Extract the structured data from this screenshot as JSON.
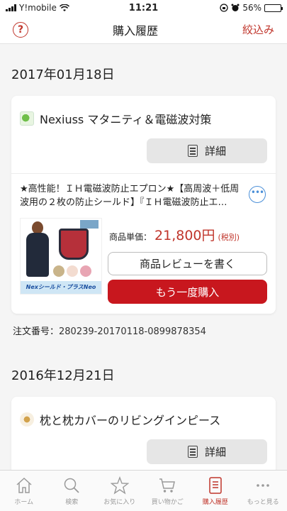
{
  "status_bar": {
    "carrier": "Y!mobile",
    "time": "11:21",
    "battery": "56%",
    "battery_level": 0.56
  },
  "header": {
    "title": "購入履歴",
    "filter_label": "絞込み"
  },
  "orders": [
    {
      "date": "2017年01月18日",
      "shop_name": "Nexiuss マタニティ＆電磁波対策",
      "detail_label": "詳細",
      "item": {
        "title": "★高性能！ＩＨ電磁波防止エプロン★【高周波＋低周波用の２枚の防止シールド】『ＩＨ電磁波防止エ…",
        "thumb_caption": "Nexシールド・プラスNeo",
        "price_label": "商品単価：",
        "price": "21,800円",
        "tax": "(税別)",
        "review_label": "商品レビューを書く",
        "rebuy_label": "もう一度購入"
      },
      "order_number_label": "注文番号：",
      "order_number": "280239-20170118-0899878354"
    },
    {
      "date": "2016年12月21日",
      "shop_name": "枕と枕カバーのリビングインピース",
      "detail_label": "詳細"
    }
  ],
  "tabs": [
    {
      "label": "ホーム",
      "icon": "home-icon"
    },
    {
      "label": "検索",
      "icon": "search-icon"
    },
    {
      "label": "お気に入り",
      "icon": "star-icon"
    },
    {
      "label": "買い物かご",
      "icon": "cart-icon"
    },
    {
      "label": "購入履歴",
      "icon": "history-icon",
      "active": true
    },
    {
      "label": "もっと見る",
      "icon": "more-icon"
    }
  ],
  "colors": {
    "accent": "#c0352b",
    "rebuy": "#c8171e",
    "more_icon": "#4a8fd8"
  }
}
